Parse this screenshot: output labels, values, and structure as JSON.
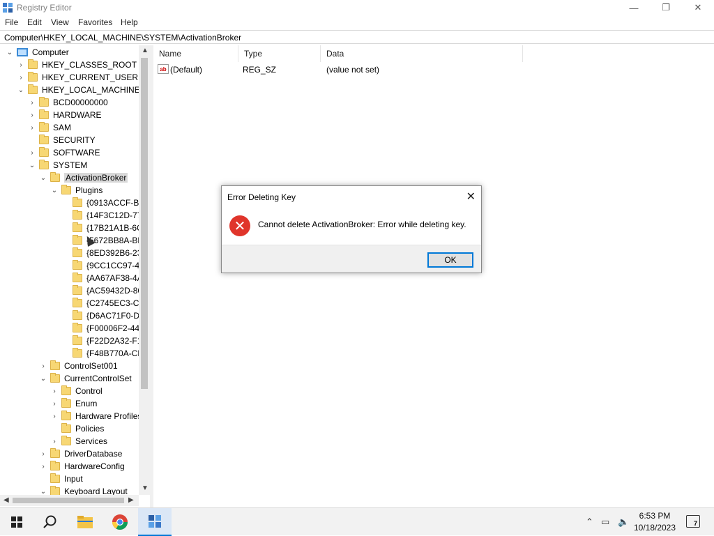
{
  "window": {
    "title": "Registry Editor",
    "controls": {
      "minimize": "—",
      "restore": "❐",
      "close": "✕"
    }
  },
  "menu": {
    "items": [
      "File",
      "Edit",
      "View",
      "Favorites",
      "Help"
    ]
  },
  "address": {
    "path": "Computer\\HKEY_LOCAL_MACHINE\\SYSTEM\\ActivationBroker"
  },
  "tree": {
    "root": "Computer",
    "items": [
      "HKEY_CLASSES_ROOT",
      "HKEY_CURRENT_USER",
      "HKEY_LOCAL_MACHINE",
      "BCD00000000",
      "HARDWARE",
      "SAM",
      "SECURITY",
      "SOFTWARE",
      "SYSTEM",
      "ActivationBroker",
      "Plugins",
      "{0913ACCF-B1",
      "{14F3C12D-77",
      "{17B21A1B-6C",
      "{5672BB8A-BB",
      "{8ED392B6-23",
      "{9CC1CC97-48",
      "{AA67AF38-4A",
      "{AC59432D-86",
      "{C2745EC3-CF",
      "{D6AC71F0-D4",
      "{F00006F2-44B",
      "{F22D2A32-F1",
      "{F48B770A-CB",
      "ControlSet001",
      "CurrentControlSet",
      "Control",
      "Enum",
      "Hardware Profiles",
      "Policies",
      "Services",
      "DriverDatabase",
      "HardwareConfig",
      "Input",
      "Keyboard Layout"
    ],
    "selected": "ActivationBroker"
  },
  "columns": {
    "name": "Name",
    "type": "Type",
    "data": "Data"
  },
  "values": [
    {
      "name": "(Default)",
      "type": "REG_SZ",
      "data": "(value not set)"
    }
  ],
  "dialog": {
    "title": "Error Deleting Key",
    "message": "Cannot delete ActivationBroker:  Error while deleting key.",
    "ok_label": "OK"
  },
  "taskbar": {
    "time": "6:53 PM",
    "date": "10/18/2023",
    "notification_count": "7"
  },
  "colors": {
    "accent": "#0078d7",
    "error": "#e0352b",
    "folder": "#f7d774"
  }
}
